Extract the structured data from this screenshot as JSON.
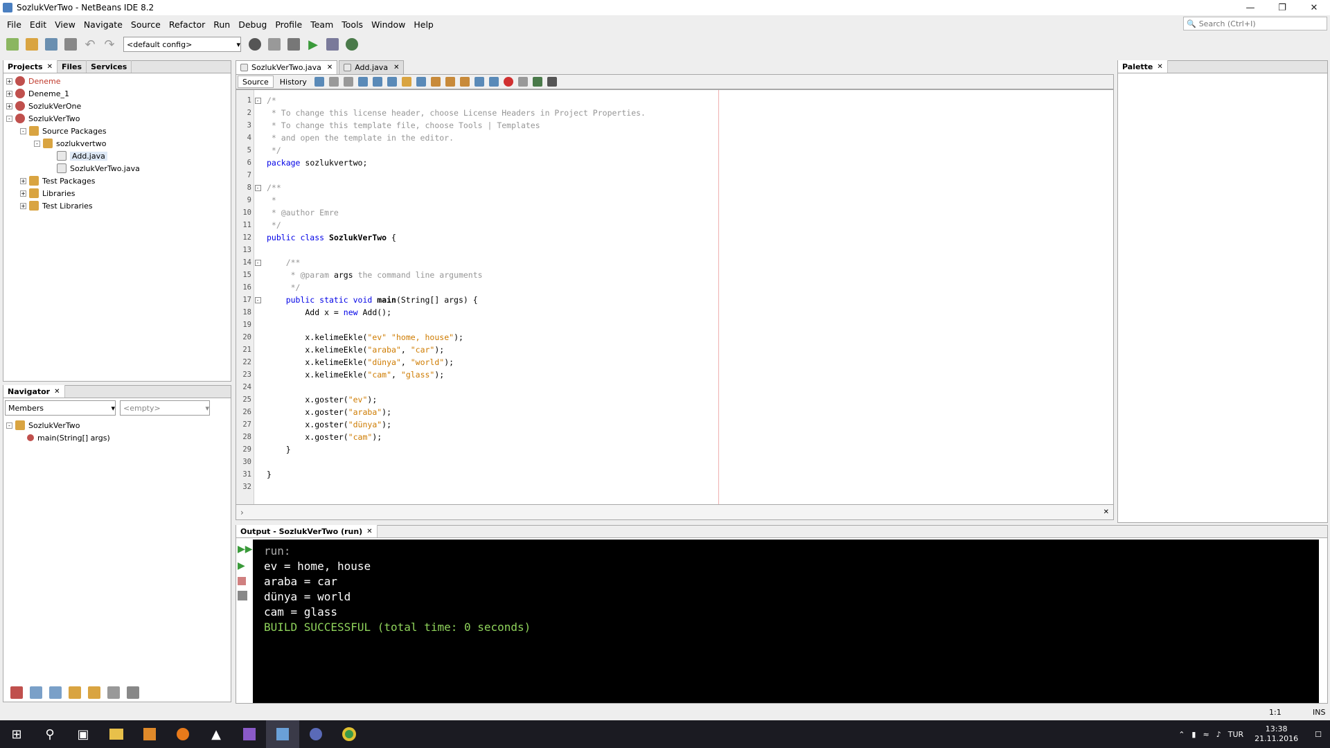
{
  "window": {
    "title": "SozlukVerTwo - NetBeans IDE 8.2"
  },
  "menu": [
    "File",
    "Edit",
    "View",
    "Navigate",
    "Source",
    "Refactor",
    "Run",
    "Debug",
    "Profile",
    "Team",
    "Tools",
    "Window",
    "Help"
  ],
  "search": {
    "placeholder": "Search (Ctrl+I)"
  },
  "toolbar": {
    "config": "<default config>"
  },
  "projects_panel": {
    "tabs": [
      "Projects",
      "Files",
      "Services"
    ],
    "tree": [
      {
        "label": "Deneme",
        "level": 0,
        "icon": "project-icon",
        "exp": "+",
        "color": "#c0392b"
      },
      {
        "label": "Deneme_1",
        "level": 0,
        "icon": "project-icon",
        "exp": "+"
      },
      {
        "label": "SozlukVerOne",
        "level": 0,
        "icon": "project-icon",
        "exp": "+"
      },
      {
        "label": "SozlukVerTwo",
        "level": 0,
        "icon": "project-icon",
        "exp": "-"
      },
      {
        "label": "Source Packages",
        "level": 1,
        "icon": "package-folder-icon",
        "exp": "-"
      },
      {
        "label": "sozlukvertwo",
        "level": 2,
        "icon": "package-icon",
        "exp": "-"
      },
      {
        "label": "Add.java",
        "level": 3,
        "icon": "java-file-icon",
        "exp": "",
        "selected": true
      },
      {
        "label": "SozlukVerTwo.java",
        "level": 3,
        "icon": "java-file-icon",
        "exp": ""
      },
      {
        "label": "Test Packages",
        "level": 1,
        "icon": "package-folder-icon",
        "exp": "+"
      },
      {
        "label": "Libraries",
        "level": 1,
        "icon": "library-icon",
        "exp": "+"
      },
      {
        "label": "Test Libraries",
        "level": 1,
        "icon": "library-icon",
        "exp": "+"
      }
    ]
  },
  "navigator": {
    "title": "Navigator",
    "members_label": "Members",
    "filter": "<empty>",
    "tree": [
      {
        "label": "SozlukVerTwo",
        "level": 0
      },
      {
        "label": "main(String[] args)",
        "level": 1
      }
    ]
  },
  "editor": {
    "tabs": [
      "SozlukVerTwo.java",
      "Add.java"
    ],
    "source_tab": "Source",
    "history_tab": "History",
    "lines": [
      {
        "n": "1",
        "fold": "-",
        "parts": [
          [
            "cm",
            "/*"
          ]
        ]
      },
      {
        "n": "2",
        "parts": [
          [
            "cm",
            " * To change this license header, choose License Headers in Project Properties."
          ]
        ]
      },
      {
        "n": "3",
        "parts": [
          [
            "cm",
            " * To change this template file, choose Tools | Templates"
          ]
        ]
      },
      {
        "n": "4",
        "parts": [
          [
            "cm",
            " * and open the template in the editor."
          ]
        ]
      },
      {
        "n": "5",
        "parts": [
          [
            "cm",
            " */"
          ]
        ]
      },
      {
        "n": "6",
        "parts": [
          [
            "kw",
            "package "
          ],
          [
            "",
            "sozlukvertwo;"
          ]
        ]
      },
      {
        "n": "7",
        "parts": []
      },
      {
        "n": "8",
        "fold": "-",
        "parts": [
          [
            "cm",
            "/**"
          ]
        ]
      },
      {
        "n": "9",
        "parts": [
          [
            "cm",
            " *"
          ]
        ]
      },
      {
        "n": "10",
        "parts": [
          [
            "cm",
            " * @author Emre"
          ]
        ]
      },
      {
        "n": "11",
        "parts": [
          [
            "cm",
            " */"
          ]
        ]
      },
      {
        "n": "12",
        "parts": [
          [
            "kw",
            "public class "
          ],
          [
            "bold",
            "SozlukVerTwo"
          ],
          [
            "",
            " {"
          ]
        ]
      },
      {
        "n": "13",
        "parts": []
      },
      {
        "n": "14",
        "fold": "-",
        "parts": [
          [
            "cm",
            "    /**"
          ]
        ]
      },
      {
        "n": "15",
        "parts": [
          [
            "cm",
            "     * @param "
          ],
          [
            "",
            "args"
          ],
          [
            "cm",
            " the command line arguments"
          ]
        ]
      },
      {
        "n": "16",
        "parts": [
          [
            "cm",
            "     */"
          ]
        ]
      },
      {
        "n": "17",
        "fold": "-",
        "parts": [
          [
            "kw",
            "    public static void "
          ],
          [
            "bold",
            "main"
          ],
          [
            "",
            "(String[] args) {"
          ]
        ]
      },
      {
        "n": "18",
        "parts": [
          [
            "",
            "        Add x = "
          ],
          [
            "kw",
            "new"
          ],
          [
            "",
            " Add();"
          ]
        ]
      },
      {
        "n": "19",
        "parts": []
      },
      {
        "n": "20",
        "parts": [
          [
            "",
            "        x.kelimeEkle("
          ],
          [
            "str",
            "\"ev\""
          ],
          [
            ",",
            ""
          ],
          [
            "",
            " "
          ],
          [
            "str",
            "\"home, house\""
          ],
          [
            "",
            ");"
          ]
        ]
      },
      {
        "n": "21",
        "parts": [
          [
            "",
            "        x.kelimeEkle("
          ],
          [
            "str",
            "\"araba\""
          ],
          [
            "",
            ", "
          ],
          [
            "str",
            "\"car\""
          ],
          [
            "",
            ");"
          ]
        ]
      },
      {
        "n": "22",
        "parts": [
          [
            "",
            "        x.kelimeEkle("
          ],
          [
            "str",
            "\"dünya\""
          ],
          [
            "",
            ", "
          ],
          [
            "str",
            "\"world\""
          ],
          [
            "",
            ");"
          ]
        ]
      },
      {
        "n": "23",
        "parts": [
          [
            "",
            "        x.kelimeEkle("
          ],
          [
            "str",
            "\"cam\""
          ],
          [
            "",
            ", "
          ],
          [
            "str",
            "\"glass\""
          ],
          [
            "",
            ");"
          ]
        ]
      },
      {
        "n": "24",
        "parts": []
      },
      {
        "n": "25",
        "parts": [
          [
            "",
            "        x.goster("
          ],
          [
            "str",
            "\"ev\""
          ],
          [
            "",
            ");"
          ]
        ]
      },
      {
        "n": "26",
        "parts": [
          [
            "",
            "        x.goster("
          ],
          [
            "str",
            "\"araba\""
          ],
          [
            "",
            ");"
          ]
        ]
      },
      {
        "n": "27",
        "parts": [
          [
            "",
            "        x.goster("
          ],
          [
            "str",
            "\"dünya\""
          ],
          [
            "",
            ");"
          ]
        ]
      },
      {
        "n": "28",
        "parts": [
          [
            "",
            "        x.goster("
          ],
          [
            "str",
            "\"cam\""
          ],
          [
            "",
            ");"
          ]
        ]
      },
      {
        "n": "29",
        "parts": [
          [
            "",
            "    }"
          ]
        ]
      },
      {
        "n": "30",
        "parts": []
      },
      {
        "n": "31",
        "parts": [
          [
            "",
            "}"
          ]
        ]
      },
      {
        "n": "32",
        "parts": []
      }
    ]
  },
  "palette": {
    "title": "Palette"
  },
  "output": {
    "title": "Output - SozlukVerTwo (run)",
    "run": "run:",
    "lines": [
      "ev = home, house",
      "araba = car",
      "dünya = world",
      "cam = glass"
    ],
    "result": "BUILD SUCCESSFUL (total time: 0 seconds)"
  },
  "status": {
    "position": "1:1",
    "mode": "INS"
  },
  "taskbar": {
    "lang": "TUR",
    "time": "13:38",
    "date": "21.11.2016"
  }
}
